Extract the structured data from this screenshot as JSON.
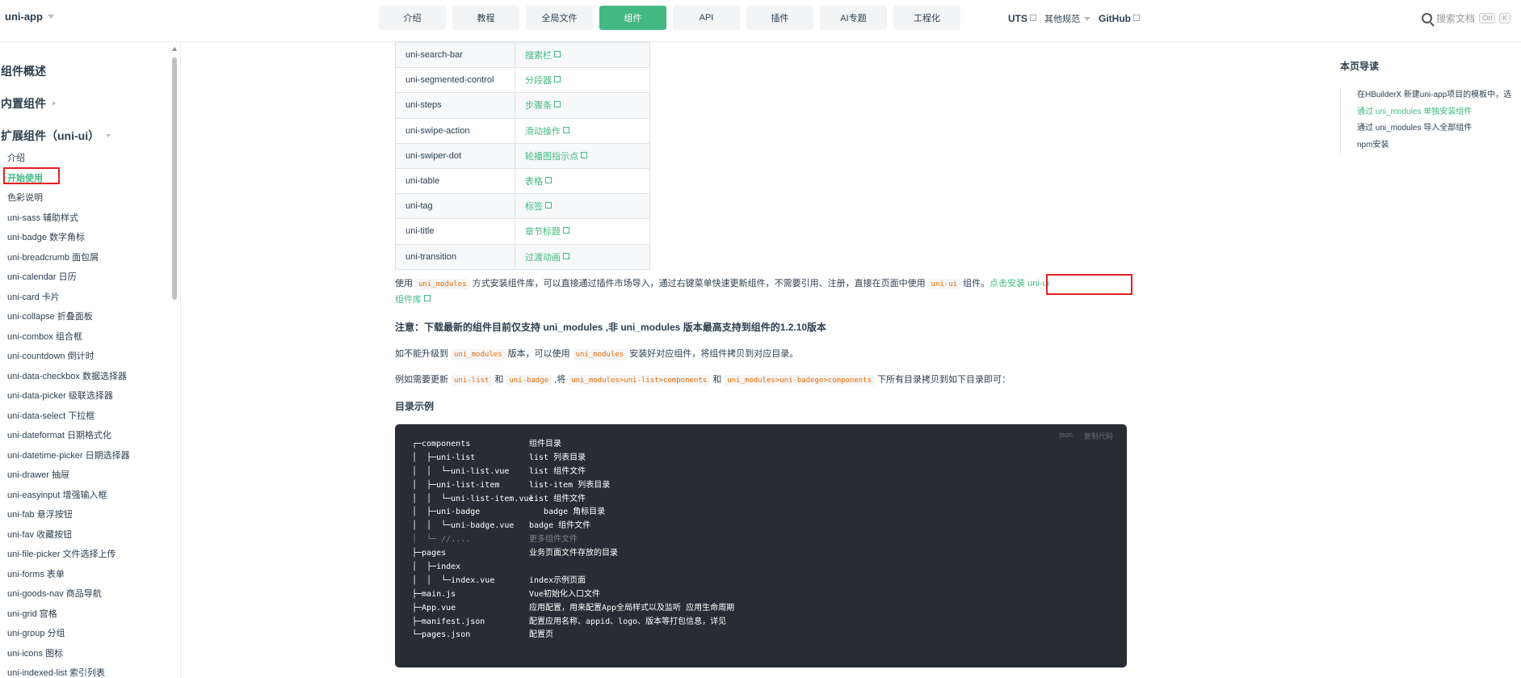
{
  "nav": {
    "brand": "uni-app",
    "buttons": [
      "介绍",
      "教程",
      "全局文件",
      "组件",
      "API",
      "插件",
      "AI专题",
      "工程化"
    ],
    "links": {
      "uts": "UTS",
      "other": "其他规范",
      "github": "GitHub"
    },
    "search_placeholder": "搜索文档",
    "kbd1": "Ctrl",
    "kbd2": "K"
  },
  "sidebar": {
    "section1": "组件概述",
    "section2": "内置组件",
    "section3": "扩展组件（uni-ui）",
    "items": [
      "介绍",
      "开始使用",
      "色彩说明",
      "uni-sass 辅助样式",
      "uni-badge 数字角标",
      "uni-breadcrumb 面包屑",
      "uni-calendar 日历",
      "uni-card 卡片",
      "uni-collapse 折叠面板",
      "uni-combox 组合框",
      "uni-countdown 倒计时",
      "uni-data-checkbox 数据选择器",
      "uni-data-picker 级联选择器",
      "uni-data-select 下拉框",
      "uni-dateformat 日期格式化",
      "uni-datetime-picker 日期选择器",
      "uni-drawer 抽屉",
      "uni-easyinput 增强输入框",
      "uni-fab 悬浮按钮",
      "uni-fav 收藏按钮",
      "uni-file-picker 文件选择上传",
      "uni-forms 表单",
      "uni-goods-nav 商品导航",
      "uni-grid 宫格",
      "uni-group 分组",
      "uni-icons 图标",
      "uni-indexed-list 索引列表"
    ]
  },
  "table": [
    [
      "uni-search-bar",
      "搜索栏"
    ],
    [
      "uni-segmented-control",
      "分段器"
    ],
    [
      "uni-steps",
      "步骤条"
    ],
    [
      "uni-swipe-action",
      "滑动操作"
    ],
    [
      "uni-swiper-dot",
      "轮播图指示点"
    ],
    [
      "uni-table",
      "表格"
    ],
    [
      "uni-tag",
      "标签"
    ],
    [
      "uni-title",
      "章节标题"
    ],
    [
      "uni-transition",
      "过渡动画"
    ]
  ],
  "content": {
    "p1_a": "使用",
    "p1_code1": "uni_modules",
    "p1_b": "方式安装组件库，可以直接通过插件市场导入，通过右键菜单快速更新组件，不需要引用、注册，直接在页面中使用",
    "p1_code2": "uni-ui",
    "p1_c": "组件。",
    "p1_link1": "点击安装 uni-ui",
    "p1_link2": "组件库",
    "note": "注意：下载最新的组件目前仅支持 uni_modules ,非 uni_modules 版本最高支持到组件的1.2.10版本",
    "p2_a": "如不能升级到",
    "p2_code": "uni_modules",
    "p2_b": "版本，可以使用",
    "p2_code2": "uni_modules",
    "p2_c": "安装好对应组件，将组件拷贝到对应目录。",
    "p3_a": "例如需要更新",
    "p3_code1": "uni-list",
    "p3_and1": "和",
    "p3_code2": "uni-badge",
    "p3_comma": ",将",
    "p3_code3": "uni_modules>uni-list>components",
    "p3_and2": "和",
    "p3_code4": "uni_modules>uni-badege>components",
    "p3_b": "下所有目录拷贝到如下目录即可：",
    "heading": "目录示例"
  },
  "code": {
    "lang": "json",
    "copy": "复制代码",
    "lines": [
      {
        "t": "┌─components",
        "c": "组件目录"
      },
      {
        "t": "│  ├─uni-list",
        "c": "list 列表目录"
      },
      {
        "t": "│  │  └─uni-list.vue",
        "c": "list 组件文件"
      },
      {
        "t": "│  ├─uni-list-item",
        "c": "list-item 列表目录"
      },
      {
        "t": "│  │  └─uni-list-item.vue",
        "c": "list 组件文件"
      },
      {
        "t": "│  ├─uni-badge",
        "c": "   badge 角标目录"
      },
      {
        "t": "│  │  └─uni-badge.vue",
        "c": "badge 组件文件"
      },
      {
        "t": "│  └─ //....",
        "c": "更多组件文件"
      },
      {
        "t": "├─pages",
        "c": "业务页面文件存放的目录"
      },
      {
        "t": "│  ├─index",
        "c": ""
      },
      {
        "t": "│  │  └─index.vue",
        "c": "index示例页面"
      },
      {
        "t": "├─main.js",
        "c": "Vue初始化入口文件"
      },
      {
        "t": "├─App.vue",
        "c": "应用配置，用来配置App全局样式以及监听 应用生命周期"
      },
      {
        "t": "├─manifest.json",
        "c": "配置应用名称、appid、logo、版本等打包信息，详见"
      },
      {
        "t": "└─pages.json",
        "c": "配置页"
      }
    ]
  },
  "toc": {
    "title": "本页导读",
    "items": [
      "在HBuilderX 新建uni-app项目的模板中，选",
      "通过 uni_modules 单独安装组件",
      "通过 uni_modules 导入全部组件",
      "npm安装"
    ]
  },
  "colors": {
    "accent": "#42b983",
    "highlight_box": "#e02020",
    "code_bg": "#282c34"
  }
}
